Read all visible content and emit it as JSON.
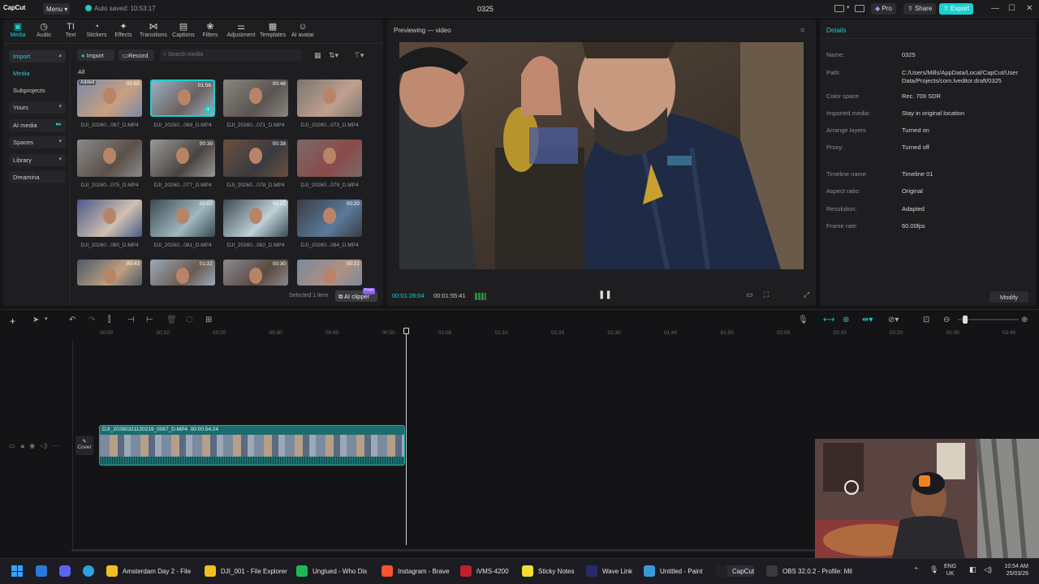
{
  "titlebar": {
    "logo": "CapCut",
    "menu": "Menu",
    "autosave": "Auto saved: 10:53:17",
    "title": "0325",
    "pro": "Pro",
    "share": "Share",
    "export": "Export"
  },
  "tabs": [
    "Media",
    "Audio",
    "Text",
    "Stickers",
    "Effects",
    "Transitions",
    "Captions",
    "Filters",
    "Adjustment",
    "Templates",
    "AI avatar"
  ],
  "sidebar": [
    "Import",
    "Media",
    "Subprojects",
    "Yours",
    "AI media",
    "Spaces",
    "Library",
    "Dreamina"
  ],
  "media": {
    "import_btn": "Import",
    "record_btn": "Record",
    "search_placeholder": "Search media",
    "filter_all": "All",
    "added_badge": "Added",
    "items": [
      {
        "name": "DJI_20260...067_D.MP4",
        "dur": "00:55"
      },
      {
        "name": "DJI_20260...069_D.MP4",
        "dur": "01:56"
      },
      {
        "name": "DJI_20260...071_D.MP4",
        "dur": "00:48"
      },
      {
        "name": "DJI_20260...073_D.MP4",
        "dur": ""
      },
      {
        "name": "DJI_20260...075_D.MP4",
        "dur": ""
      },
      {
        "name": "DJI_20260...077_D.MP4",
        "dur": "00:39"
      },
      {
        "name": "DJI_20260...078_D.MP4",
        "dur": "00:38"
      },
      {
        "name": "DJI_20260...079_D.MP4",
        "dur": ""
      },
      {
        "name": "DJI_20260...080_D.MP4",
        "dur": ""
      },
      {
        "name": "DJI_20260...081_D.MP4",
        "dur": "00:02"
      },
      {
        "name": "DJI_20260...082_D.MP4",
        "dur": "00:15"
      },
      {
        "name": "DJI_20260...084_D.MP4",
        "dur": "00:20"
      },
      {
        "name": "",
        "dur": "00:43"
      },
      {
        "name": "",
        "dur": "01:22"
      },
      {
        "name": "",
        "dur": "00:30"
      },
      {
        "name": "",
        "dur": "00:21"
      }
    ],
    "selected": "Selected 1 item",
    "ai_clipper": "AI clipper",
    "free": "Free"
  },
  "preview": {
    "title": "Previewing — video",
    "current": "00:01:28:04",
    "total": "00:01:55:41"
  },
  "details": {
    "title": "Details",
    "rows": [
      {
        "k": "Name:",
        "v": "0325"
      },
      {
        "k": "Path:",
        "v": "C:/Users/Mills/AppData/Local/CapCut/User Data/Projects/com.lveditor.draft/0325"
      },
      {
        "k": "Color space",
        "v": "Rec. 709 SDR"
      },
      {
        "k": "Imported media:",
        "v": "Stay in original location"
      },
      {
        "k": "Arrange layers",
        "v": "Turned on"
      },
      {
        "k": "Proxy:",
        "v": "Turned off"
      },
      {
        "k": "Timeline name",
        "v": "Timeline 01"
      },
      {
        "k": "Aspect ratio:",
        "v": "Original"
      },
      {
        "k": "Resolution:",
        "v": "Adapted"
      },
      {
        "k": "Frame rate:",
        "v": "60.00fps"
      }
    ],
    "modify": "Modify"
  },
  "timeline": {
    "ruler": [
      "00:00",
      "00:10",
      "00:20",
      "00:30",
      "00:40",
      "00:50",
      "01:00",
      "01:10",
      "01:20",
      "01:30",
      "01:40",
      "01:50",
      "02:00",
      "02:10",
      "02:20",
      "02:30",
      "02:40"
    ],
    "clip_name": "DJI_20260321120219_0067_D.MP4",
    "clip_dur": "00:00:54:24",
    "cover": "Cover"
  },
  "taskbar": {
    "items": [
      "Amsterdam Day 2 - File",
      "DJI_001 - File Explorer",
      "Unglued - Who Dis",
      "Instagram - Brave",
      "iVMS-4200",
      "Sticky Notes",
      "Wave Link",
      "Untitled - Paint",
      "CapCut",
      "OBS 32.0.2 - Profile: Mil"
    ],
    "lang1": "ENG",
    "lang2": "UK",
    "time": "10:54 AM",
    "date": "25/03/26"
  },
  "colors": {
    "accent": "#1ad0d0",
    "panel": "#1e1e21",
    "bg": "#141416",
    "clip": "#1a6e6e"
  }
}
